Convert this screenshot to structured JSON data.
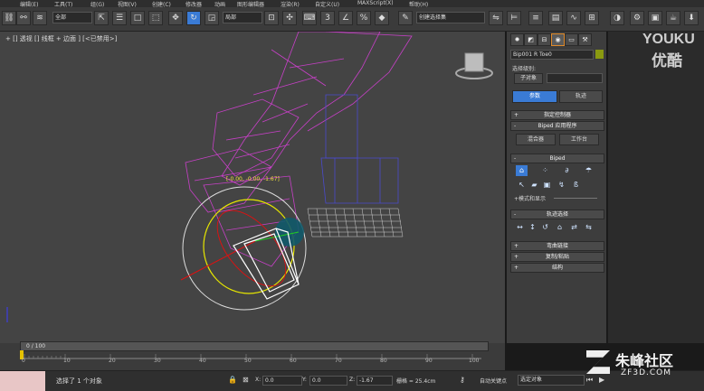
{
  "menu": [
    "编辑(E)",
    "工具(T)",
    "组(G)",
    "视图(V)",
    "创建(C)",
    "修改器",
    "动画",
    "图形编辑器",
    "渲染(R)",
    "MAXScript(X)",
    "帮助(H)",
    "自定义(U)"
  ],
  "toolbar": {
    "selection_filter": "全部",
    "ref_coord": "局部",
    "named_selection": "创建选择集"
  },
  "viewport": {
    "label": "+ [] 透视 [] 线框 + 边面 ] [<已禁用>]",
    "coord_readout": "[-0.00, -0.00, -1.67]"
  },
  "command_panel": {
    "tabs": [
      "create-icon",
      "modify-icon",
      "hierarchy-icon",
      "motion-icon",
      "display-icon",
      "utilities-icon"
    ],
    "object_name": "Bip001 R Toe0",
    "selection_level_label": "选择级别:",
    "sub_object_label": "子对象",
    "param_button": "参数",
    "track_button": "轨迹",
    "rollouts": {
      "assign_controller": "指定控制器",
      "biped_apps": "Biped 应用程序",
      "mixer": "混合器",
      "workbench": "工作台",
      "biped": "Biped",
      "modes_display": "+模式和显示",
      "track_selection": "轨迹选择",
      "bend_links": "弯曲链接",
      "copy_paste": "复制/粘贴",
      "structure": "结构"
    }
  },
  "timeline": {
    "slider_text": "0 / 100",
    "ticks": [
      "0",
      "10",
      "20",
      "30",
      "40",
      "50",
      "60",
      "70",
      "80",
      "90",
      "100"
    ]
  },
  "status": {
    "message": "选择了 1 个对象",
    "x_label": "X:",
    "x_value": "0.0",
    "y_label": "Y:",
    "y_value": "0.0",
    "z_label": "Z:",
    "z_value": "-1.67",
    "grid_label": "栅格 = 25.4cm",
    "auto_key": "自动关键点",
    "selected_objects": "选定对象"
  },
  "watermarks": {
    "youku_en": "YOUKU",
    "youku_cn": "优酷",
    "zf_cn": "朱峰社区",
    "zf_url": "ZF3D.COM"
  }
}
